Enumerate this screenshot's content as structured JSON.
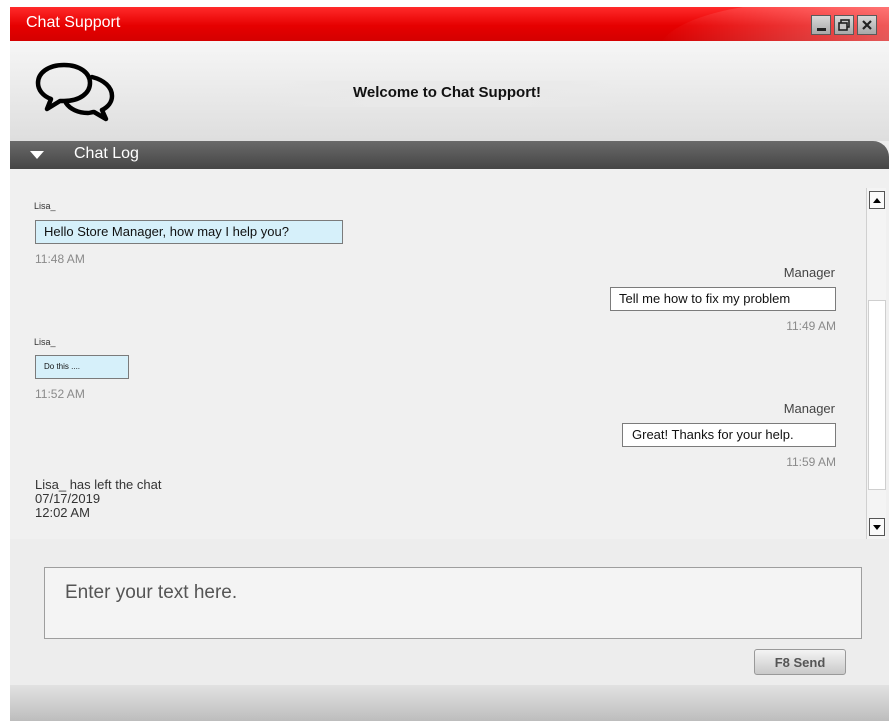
{
  "window": {
    "title": "Chat Support"
  },
  "header": {
    "welcome": "Welcome to Chat Support!"
  },
  "section": {
    "title": "Chat Log"
  },
  "messages": [
    {
      "sender": "Lisa_",
      "text": "Hello Store Manager, how may I help you?",
      "time": "11:48 AM"
    },
    {
      "sender": "Manager",
      "text": "Tell me how to fix my problem",
      "time": "11:49 AM"
    },
    {
      "sender": "Lisa_",
      "text": "Do this ....",
      "time": "11:52 AM"
    },
    {
      "sender": "Manager",
      "text": "Great! Thanks for your help.",
      "time": "11:59 AM"
    }
  ],
  "system_message": {
    "text": "Lisa_ has left the chat",
    "date": "07/17/2019",
    "time": "12:02 AM"
  },
  "input": {
    "placeholder": "Enter your text here."
  },
  "send_button": {
    "label": "F8 Send"
  },
  "colors": {
    "titlebar": "#e60000",
    "agent_bubble": "#d6f0fa",
    "section_bar": "#505050"
  }
}
